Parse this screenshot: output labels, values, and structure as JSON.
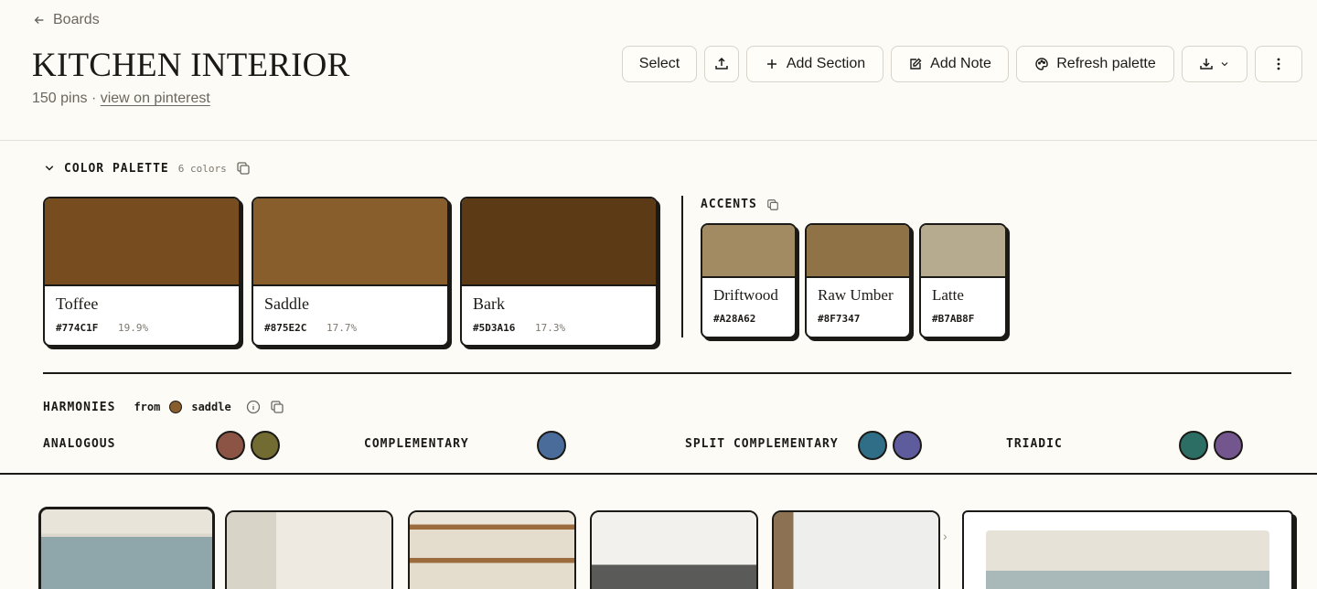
{
  "header": {
    "back_label": "Boards",
    "title": "KITCHEN INTERIOR",
    "pins_count": "150 pins ·",
    "pinterest_link": "view on pinterest"
  },
  "toolbar": {
    "select_label": "Select",
    "add_section_label": "Add Section",
    "add_note_label": "Add Note",
    "refresh_label": "Refresh palette"
  },
  "palette": {
    "label": "COLOR PALETTE",
    "count": "6 colors",
    "primary": [
      {
        "name": "Toffee",
        "hex": "#774C1F",
        "pct": "19.9%",
        "color": "#774C1F"
      },
      {
        "name": "Saddle",
        "hex": "#875E2C",
        "pct": "17.7%",
        "color": "#875E2C"
      },
      {
        "name": "Bark",
        "hex": "#5D3A16",
        "pct": "17.3%",
        "color": "#5D3A16"
      }
    ],
    "accents_label": "ACCENTS",
    "accents": [
      {
        "name": "Driftwood",
        "hex": "#A28A62",
        "color": "#A28A62"
      },
      {
        "name": "Raw Umber",
        "hex": "#8F7347",
        "color": "#8F7347"
      },
      {
        "name": "Latte",
        "hex": "#B7AB8F",
        "color": "#B7AB8F"
      }
    ]
  },
  "harmonies": {
    "label": "HARMONIES",
    "from_label": "from",
    "source_name": "saddle",
    "source_color": "#875E2C",
    "groups": [
      {
        "label": "ANALOGOUS",
        "colors": [
          "#8B5444",
          "#726B32"
        ]
      },
      {
        "label": "COMPLEMENTARY",
        "colors": [
          "#4A6C9A"
        ]
      },
      {
        "label": "SPLIT COMPLEMENTARY",
        "colors": [
          "#2F6E86",
          "#5E5C9C"
        ]
      },
      {
        "label": "TRIADIC",
        "colors": [
          "#2C6E63",
          "#74568F"
        ]
      }
    ]
  }
}
